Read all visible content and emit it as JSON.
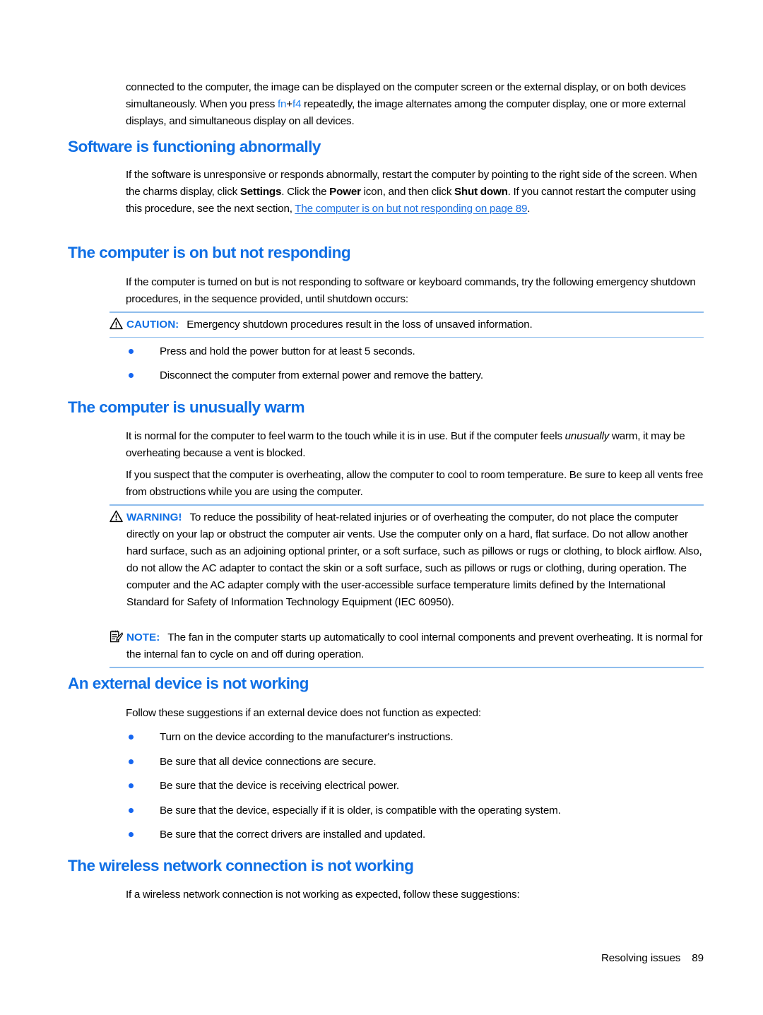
{
  "document": {
    "intro_paragraph": {
      "part1": "connected to the computer, the image can be displayed on the computer screen or the external display, or on both devices simultaneously. When you press ",
      "key1": "fn",
      "plus": "+",
      "key2": "f4",
      "part2": " repeatedly, the image alternates among the computer display, one or more external displays, and simultaneous display on all devices."
    },
    "sections": [
      {
        "heading": "Software is functioning abnormally",
        "paragraph": {
          "part1": "If the software is unresponsive or responds abnormally, restart the computer by pointing to the right side of the screen. When the charms display, click ",
          "bold1": "Settings",
          "part2": ". Click the ",
          "bold2": "Power",
          "part3": " icon, and then click ",
          "bold3": "Shut down",
          "part4": ". If you cannot restart the computer using this procedure, see the next section, ",
          "link": "The computer is on but not responding on page 89",
          "part5": "."
        }
      },
      {
        "heading": "The computer is on but not responding",
        "paragraph": "If the computer is turned on but is not responding to software or keyboard commands, try the following emergency shutdown procedures, in the sequence provided, until shutdown occurs:",
        "caution": {
          "icon": "warning-triangle-icon",
          "label": "CAUTION:",
          "text": "Emergency shutdown procedures result in the loss of unsaved information."
        },
        "bullets": [
          "Press and hold the power button for at least 5 seconds.",
          "Disconnect the computer from external power and remove the battery."
        ]
      },
      {
        "heading": "The computer is unusually warm",
        "paragraph1": {
          "part1": "It is normal for the computer to feel warm to the touch while it is in use. But if the computer feels ",
          "italic": "unusually",
          "part2": " warm, it may be overheating because a vent is blocked."
        },
        "paragraph2": "If you suspect that the computer is overheating, allow the computer to cool to room temperature. Be sure to keep all vents free from obstructions while you are using the computer.",
        "warning": {
          "icon": "warning-triangle-icon",
          "label": "WARNING!",
          "text": "To reduce the possibility of heat-related injuries or of overheating the computer, do not place the computer directly on your lap or obstruct the computer air vents. Use the computer only on a hard, flat surface. Do not allow another hard surface, such as an adjoining optional printer, or a soft surface, such as pillows or rugs or clothing, to block airflow. Also, do not allow the AC adapter to contact the skin or a soft surface, such as pillows or rugs or clothing, during operation. The computer and the AC adapter comply with the user-accessible surface temperature limits defined by the International Standard for Safety of Information Technology Equipment (IEC 60950)."
        },
        "note": {
          "icon": "notepad-pencil-icon",
          "label": "NOTE:",
          "text": "The fan in the computer starts up automatically to cool internal components and prevent overheating. It is normal for the internal fan to cycle on and off during operation."
        }
      },
      {
        "heading": "An external device is not working",
        "paragraph": "Follow these suggestions if an external device does not function as expected:",
        "bullets": [
          "Turn on the device according to the manufacturer's instructions.",
          "Be sure that all device connections are secure.",
          "Be sure that the device is receiving electrical power.",
          "Be sure that the device, especially if it is older, is compatible with the operating system.",
          "Be sure that the correct drivers are installed and updated."
        ]
      },
      {
        "heading": "The wireless network connection is not working",
        "paragraph": "If a wireless network connection is not working as expected, follow these suggestions:"
      }
    ],
    "footer": {
      "chapter": "Resolving issues",
      "page_number": "89"
    },
    "colors": {
      "heading_blue": "#0f6fe5",
      "link_blue": "#1a6fe0",
      "bullet_blue": "#1565f0",
      "rule_blue": "#8fbdec",
      "body_black": "#000000"
    }
  }
}
